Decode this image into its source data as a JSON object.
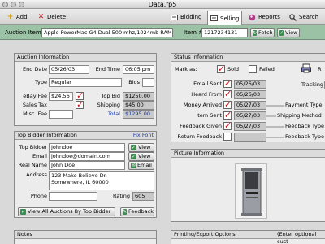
{
  "window": {
    "title": "Data.fp5"
  },
  "toolbar": {
    "add": "Add",
    "delete": "Delete",
    "bidding": "Bidding",
    "selling": "Selling",
    "reports": "Reports",
    "search": "Search"
  },
  "auction_bar": {
    "auction_item_label": "Auction Item",
    "auction_item_value": "Apple PowerMac G4 Dual 500 mhz/1024mb RAM",
    "item_no_label": "Item #",
    "item_no_value": "1217234131",
    "fetch": "Fetch",
    "view": "View"
  },
  "auction_info": {
    "title": "Auction Information",
    "end_date_label": "End Date",
    "end_date": "05/26/03",
    "end_time_label": "End Time",
    "end_time": "06:05 pm",
    "type_label": "Type",
    "type": "Regular",
    "bids_label": "Bids",
    "ebay_fee_label": "eBay Fee",
    "ebay_fee": "$24.56",
    "top_bid_label": "Top Bid",
    "top_bid": "$1250.00",
    "sales_tax_label": "Sales Tax",
    "shipping_label": "Shipping",
    "shipping": "$45.00",
    "misc_fee_label": "Misc. Fee",
    "total_label": "Total",
    "total": "$1295.00"
  },
  "top_bidder": {
    "title": "Top Bidder Information",
    "fix_font": "Fix Font",
    "top_bidder_label": "Top Bidder",
    "top_bidder": "Johndoe",
    "email_label": "Email",
    "email": "johndoe@domain.com",
    "real_name_label": "Real Name",
    "real_name": "John Doe",
    "address_label": "Address",
    "address_line1": "123 Make Believe Dr.",
    "address_line2": "Somewhere, IL 60000",
    "phone_label": "Phone",
    "rating_label": "Rating",
    "rating": "605",
    "view": "View",
    "email_btn": "Email",
    "view_all": "View All Auctions By Top Bidder",
    "feedback": "Feedback"
  },
  "status_info": {
    "title": "Status Information",
    "mark_as_label": "Mark as:",
    "sold": "Sold",
    "failed": "Failed",
    "tracking_label": "Tracking",
    "email_sent_label": "Email Sent",
    "email_sent": "05/26/03",
    "heard_from_label": "Heard From",
    "heard_from": "05/26/03",
    "money_arrived_label": "Money Arrived",
    "money_arrived": "05/27/03",
    "item_sent_label": "Item Sent",
    "item_sent": "05/27/03",
    "feedback_given_label": "Feedback Given",
    "feedback_given": "05/27/03",
    "return_feedback_label": "Return Feedback",
    "payment_type_label": "Payment Type",
    "shipping_method_label": "Shipping Method",
    "feedback_type_label": "Feedback Type"
  },
  "picture_info": {
    "title": "Picture Information"
  },
  "notes": {
    "title": "Notes"
  },
  "printing": {
    "title": "Printing/Export Options",
    "hint": "(Enter optional cust"
  },
  "colors": {
    "auction_bar": "#9cc2a6",
    "check_red": "#c0151b",
    "link_blue": "#1a3ab0"
  }
}
